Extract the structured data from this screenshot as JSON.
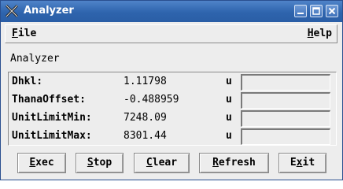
{
  "window": {
    "title": "Analyzer",
    "icon": "x-logo-icon"
  },
  "menubar": {
    "file": {
      "first": "F",
      "rest": "ile"
    },
    "help": {
      "first": "H",
      "rest": "elp"
    }
  },
  "panel": {
    "label": "Analyzer",
    "rows": [
      {
        "label": "Dhkl:",
        "value": "1.11798",
        "unit": "u",
        "input": ""
      },
      {
        "label": "ThanaOffset:",
        "value": "-0.488959",
        "unit": "u",
        "input": ""
      },
      {
        "label": "UnitLimitMin:",
        "value": "7248.09",
        "unit": "u",
        "input": ""
      },
      {
        "label": "UnitLimitMax:",
        "value": "8301.44",
        "unit": "u",
        "input": ""
      }
    ]
  },
  "buttons": {
    "exec": {
      "first": "E",
      "rest": "xec"
    },
    "stop": {
      "first": "S",
      "rest": "top"
    },
    "clear": {
      "first": "C",
      "rest": "lear"
    },
    "refresh": {
      "first": "R",
      "rest": "efresh"
    },
    "exit": {
      "pre": "E",
      "first": "x",
      "rest": "it"
    }
  },
  "colors": {
    "titlebar": "#2e64ad",
    "background": "#ededed"
  }
}
